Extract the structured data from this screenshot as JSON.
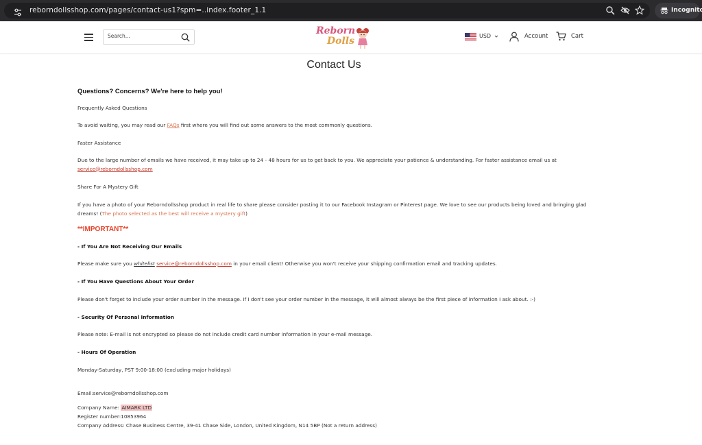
{
  "browser": {
    "url": "reborndollsshop.com/pages/contact-us1?spm=..index.footer_1.1",
    "incognito_label": "Incognito",
    "icons": [
      "tune-icon",
      "zoom-icon",
      "eye-off-icon",
      "star-icon",
      "incognito-icon"
    ]
  },
  "header": {
    "search_placeholder": "Search...",
    "logo_line1": "Reborn",
    "logo_line2": "Dolls",
    "currency": "USD",
    "account_label": "Account",
    "cart_label": "Cart"
  },
  "content": {
    "title": "Contact Us",
    "intro_heading": "Questions? Concerns? We're here to help you!",
    "faq_heading": "Frequently Asked Questions",
    "faq_text_before": "To avoid waiting, you may read our ",
    "faq_link": "FAQs",
    "faq_text_after": " first where you will find out some answers to the most commonly questions.",
    "fast_heading": "Faster Assistance",
    "fast_text": "Due to the large number of emails we have received, it may take up to 24 - 48 hours for us to get back to you. We appreciate your patience & understanding.  For faster assistance email us at ",
    "fast_email": "service@reborndollsshop.com",
    "share_heading": "Share  For  A  Mystery Gift",
    "share_text": "If you have a photo of your  Reborndollsshop product in real life to share please consider posting it to our  Facebook  Instagram or  Pinterest page. We love to see our products being loved and bringing glad dreams! (",
    "share_highlight": "The photo selected as the best will receive a mystery gift",
    "share_close": ")",
    "important": "**IMPORTANT**",
    "emails_heading": "-  If You Are  Not  Receiving Our  Emails",
    "emails_text_before": "Please make sure you ",
    "emails_whitelist": "whitelist",
    "emails_space": " ",
    "emails_link": "service@reborndollsshop.com",
    "emails_text_after": " in your email client! Otherwise you won't receive your shipping confirmation email and tracking updates.",
    "order_heading": "-  If You  Have Questions About Your Order",
    "order_text": "Please don't forget to include your order number in the message.  If  I don't see your order number in the message, it will almost always be the first piece of information  I ask about. :-)",
    "security_heading": "- Security Of  Personal  Information",
    "security_text": "Please note:  E-mail is not encrypted so please do not include credit card number information in your e-mail message.",
    "hours_heading": "-  Hours Of Operation",
    "hours_text": "Monday-Saturday,  PST 9:00-18:00 (excluding major holidays)",
    "email_line": "Email:service@reborndollsshop.com",
    "company_label": "Company  Name: ",
    "company_name": "AIMARK  LTD",
    "register_line": "Register number:10853964",
    "address_line": "Company Address: Chase  Business Centre, 39-41 Chase Side,  London, United  Kingdom,  N14 5BP (Not a return address)"
  }
}
